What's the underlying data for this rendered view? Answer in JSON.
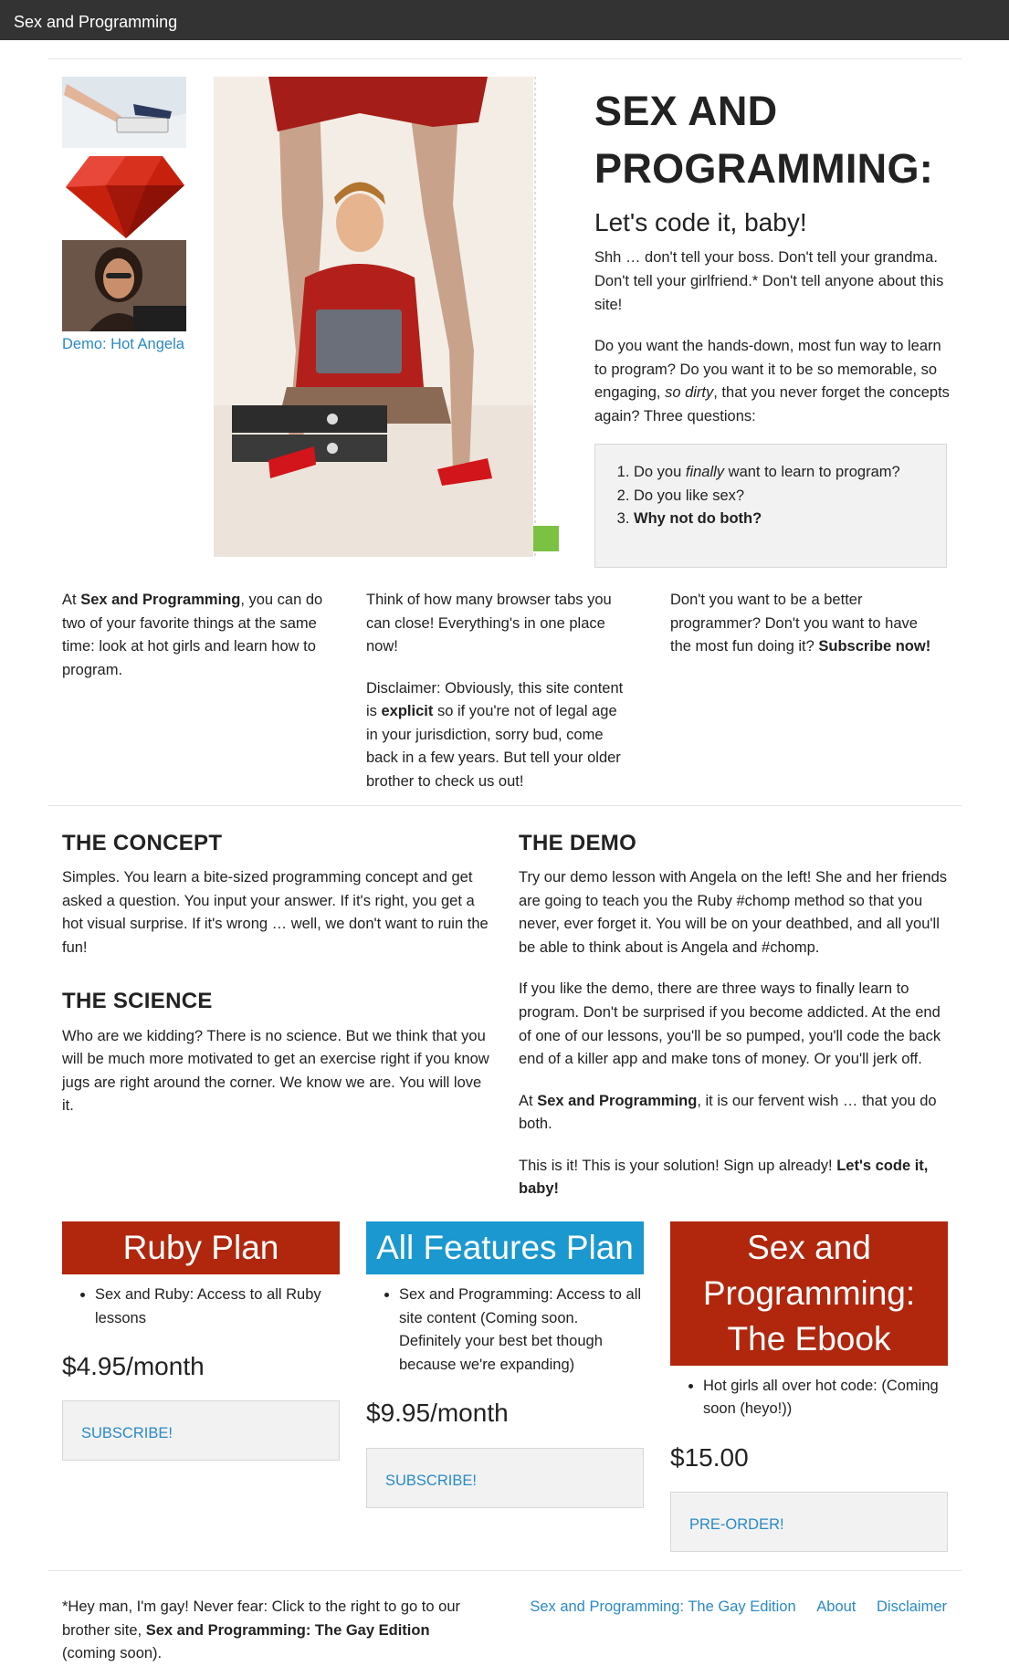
{
  "nav": {
    "brand": "Sex and Programming"
  },
  "sidebar": {
    "demo_link": "Demo: Hot Angela"
  },
  "hero": {
    "title": "SEX AND PROGRAMMING:",
    "subtitle": "Let's code it, baby!",
    "p1": "Shh … don't tell your boss. Don't tell your grandma. Don't tell your girlfriend.* Don't tell anyone about this site!",
    "p2_a": "Do you want the hands-down, most fun way to learn to program? Do you want it to be so memorable, so engaging, ",
    "p2_em": "so dirty",
    "p2_b": ", that you never forget the concepts again? Three questions:"
  },
  "questions": {
    "q1_a": "Do you ",
    "q1_em": "finally",
    "q1_b": " want to learn to program?",
    "q2": "Do you like sex?",
    "q3": "Why not do both?"
  },
  "intro": {
    "col1_a": "At ",
    "col1_strong": "Sex and Programming",
    "col1_b": ", you can do two of your favorite things at the same time: look at hot girls and learn how to program.",
    "col2_p1": "Think of how many browser tabs you can close! Everything's in one place now!",
    "col2_p2_a": "Disclaimer: Obviously, this site content is ",
    "col2_p2_strong": "explicit",
    "col2_p2_b": " so if you're not of legal age in your jurisdiction, sorry bud, come back in a few years. But tell your older brother to check us out!",
    "col3_a": "Don't you want to be a better programmer? Don't you want to have the most fun doing it? ",
    "col3_strong": "Subscribe now!"
  },
  "concept": {
    "heading": "THE CONCEPT",
    "text": "Simples. You learn a bite-sized programming concept and get asked a question. You input your answer. If it's right, you get a hot visual surprise. If it's wrong … well, we don't want to ruin the fun!"
  },
  "science": {
    "heading": "THE SCIENCE",
    "text": "Who are we kidding? There is no science. But we think that you will be much more motivated to get an exercise right if you know jugs are right around the corner. We know we are. You will love it."
  },
  "demo": {
    "heading": "THE DEMO",
    "p1": "Try our demo lesson with Angela on the left! She and her friends are going to teach you the Ruby #chomp method so that you never, ever forget it. You will be on your deathbed, and all you'll be able to think about is Angela and #chomp.",
    "p2": "If you like the demo, there are three ways to finally learn to program. Don't be surprised if you become addicted. At the end of one of our lessons, you'll be so pumped, you'll code the back end of a killer app and make tons of money. Or you'll jerk off.",
    "p3_a": "At ",
    "p3_strong": "Sex and Programming",
    "p3_b": ", it is our fervent wish … that you do both.",
    "p4_a": "This is it! This is your solution! Sign up already! ",
    "p4_strong": "Let's code it, baby!"
  },
  "plans": [
    {
      "title": "Ruby Plan",
      "feature": "Sex and Ruby: Access to all Ruby lessons",
      "price": "$4.95/month",
      "button": "SUBSCRIBE!",
      "color": "#b0270e"
    },
    {
      "title": "All Features Plan",
      "feature": "Sex and Programming: Access to all site content (Coming soon. Definitely your best bet though because we're expanding)",
      "price": "$9.95/month",
      "button": "SUBSCRIBE!",
      "color": "#1b98cf"
    },
    {
      "title": "Sex and Programming: The Ebook",
      "feature": "Hot girls all over hot code: (Coming soon (heyo!))",
      "price": "$15.00",
      "button": "PRE-ORDER!",
      "color": "#b0270e"
    }
  ],
  "footer": {
    "note_a": "*Hey man, I'm gay! Never fear: Click to the right to go to our brother site, ",
    "note_strong": "Sex and Programming: The Gay Edition",
    "note_b": " (coming soon).",
    "links": [
      "Sex and Programming: The Gay Edition",
      "About",
      "Disclaimer"
    ]
  },
  "theme": {
    "accent": "#2a8ac6",
    "nav_bg": "#333333",
    "plan_red": "#b0270e",
    "plan_blue": "#1b98cf",
    "panel_bg": "#f2f2f2"
  }
}
